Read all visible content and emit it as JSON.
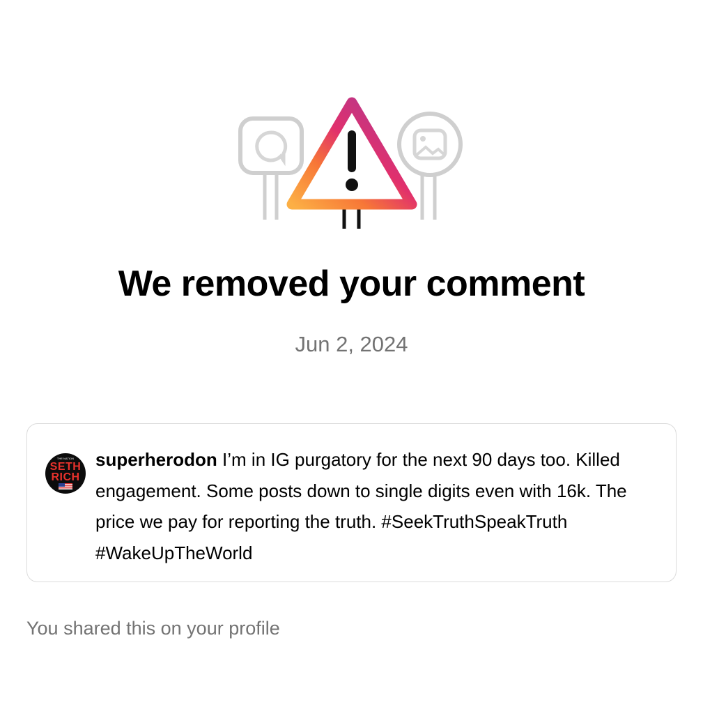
{
  "notice": {
    "title": "We removed your comment",
    "date": "Jun 2, 2024"
  },
  "comment": {
    "avatar_text_top": "THE NATION",
    "avatar_text_line1": "SETH",
    "avatar_text_line2": "RICH",
    "username": "superherodon",
    "text": "I’m in IG purgatory for the next 90 days too. Killed engagement. Some posts down to single digits even with 16k. The price we pay for reporting the truth. #SeekTruthSpeakTruth #WakeUpTheWorld"
  },
  "footer": {
    "shared_note": "You shared this on your profile"
  },
  "icons": {
    "warning": "warning-triangle-icon",
    "comment_sign": "chat-bubble-icon",
    "image_sign": "image-icon"
  },
  "colors": {
    "gradient": [
      "#8a3ab9",
      "#e1306c",
      "#fd1d1d",
      "#f77737",
      "#fcaf45"
    ],
    "muted_text": "#737373",
    "border": "#dbdbdb"
  }
}
